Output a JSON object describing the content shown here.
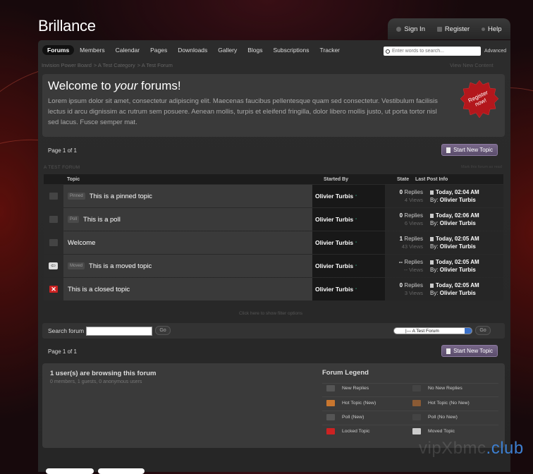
{
  "app": {
    "title": "Brillance"
  },
  "top_links": [
    {
      "label": "Sign In"
    },
    {
      "label": "Register"
    },
    {
      "label": "Help"
    }
  ],
  "nav": {
    "tabs": [
      "Forums",
      "Members",
      "Calendar",
      "Pages",
      "Downloads",
      "Gallery",
      "Blogs",
      "Subscriptions",
      "Tracker"
    ],
    "active": "Forums"
  },
  "search": {
    "placeholder": "Enter words to search...",
    "advanced": "Advanced"
  },
  "breadcrumb": [
    "Invision Power Board",
    "> A Test Category",
    "> A Test Forum"
  ],
  "view_new_content": "View New Content",
  "welcome": {
    "title_pre": "Welcome to ",
    "title_em": "your",
    "title_post": " forums!",
    "body": "Lorem ipsum dolor sit amet, consectetur adipiscing elit. Maecenas faucibus pellentesque quam sed consectetur. Vestibulum facilisis lectus id arcu dignissim ac rutrum sem posuere. Aenean mollis, turpis et eleifend fringilla, dolor libero mollis justo, ut porta tortor nisl sed lacus. Fusce semper mat.",
    "badge": [
      "Register",
      "now!"
    ]
  },
  "pager": {
    "label": "Page 1 of 1"
  },
  "start_topic": "Start New Topic",
  "forum_label": "A TEST FORUM",
  "forum_label_right": "Mark this forum as read",
  "columns": {
    "topic": "Topic",
    "started_by": "Started By",
    "state": "State",
    "last_post": "Last Post Info"
  },
  "topics": [
    {
      "tag": "Pinned",
      "title": "This is a pinned topic",
      "starter": "Olivier Turbis",
      "replies": "0",
      "views": "4 Views",
      "last_time": "Today, 02:04 AM",
      "by": "By:",
      "last_by": "Olivier Turbis",
      "icon": "folder-icon"
    },
    {
      "tag": "Poll",
      "title": "This is a poll",
      "starter": "Olivier Turbis",
      "replies": "0",
      "views": "6 Views",
      "last_time": "Today, 02:06 AM",
      "by": "By:",
      "last_by": "Olivier Turbis",
      "icon": "poll-icon"
    },
    {
      "tag": "",
      "title": "Welcome",
      "starter": "Olivier Turbis",
      "replies": "1",
      "views": "43 Views",
      "last_time": "Today, 02:05 AM",
      "by": "By:",
      "last_by": "Olivier Turbis",
      "icon": "folder-icon"
    },
    {
      "tag": "Moved",
      "title": "This is a moved topic",
      "starter": "Olivier Turbis",
      "replies": "--",
      "views": "-- Views",
      "last_time": "Today, 02:05 AM",
      "by": "By:",
      "last_by": "Olivier Turbis",
      "icon": "moved-icon"
    },
    {
      "tag": "",
      "title": "This is a closed topic",
      "starter": "Olivier Turbis",
      "replies": "0",
      "views": "3 Views",
      "last_time": "Today, 02:05 AM",
      "by": "By:",
      "last_by": "Olivier Turbis",
      "icon": "locked-icon"
    }
  ],
  "replies_word": "Replies",
  "state_options": "Click here to show filter options",
  "search_forum": {
    "label": "Search forum",
    "go": "Go",
    "jump_value": "|--- A Test Forum",
    "jump_go": "Go"
  },
  "browsing": {
    "title": "1 user(s) are browsing this forum",
    "subtitle": "0 members, 1 guests, 0 anonymous users"
  },
  "legend": {
    "title": "Forum Legend",
    "items": [
      "New Replies",
      "No New Replies",
      "Hot Topic (New)",
      "Hot Topic (No New)",
      "Poll (New)",
      "Poll (No New)",
      "Locked Topic",
      "Moved Topic"
    ]
  },
  "watermark": {
    "a": "vipXbmc",
    "b": ".club"
  },
  "colors": {
    "accent": "#5a4d6b",
    "bg": "#17090c",
    "panel": "#2c2c2c"
  }
}
